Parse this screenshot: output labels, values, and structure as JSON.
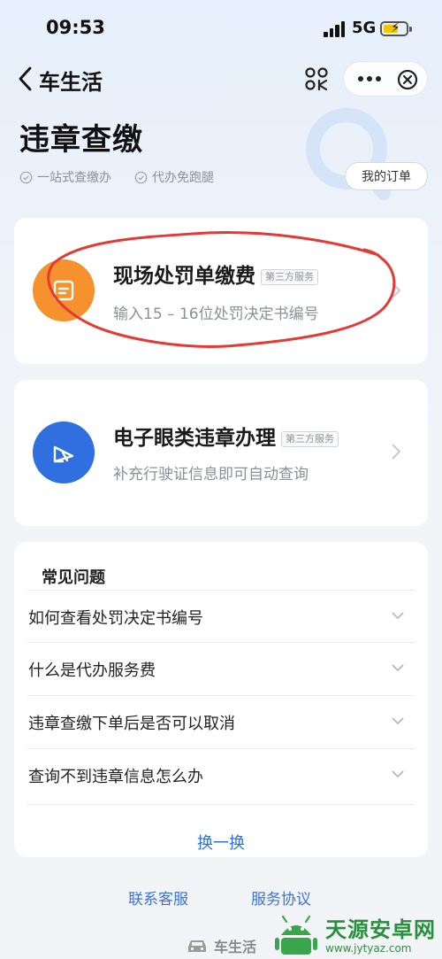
{
  "status_bar": {
    "time": "09:53",
    "network": "5G"
  },
  "nav": {
    "title": "车生活",
    "icons": [
      "back-chevron-icon",
      "scan-icon",
      "more-icon",
      "close-icon"
    ]
  },
  "header": {
    "title": "违章查缴",
    "features": [
      "一站式查缴办",
      "代办免跑腿"
    ],
    "orders_button": "我的订单"
  },
  "services": [
    {
      "title": "现场处罚单缴费",
      "badge": "第三方服务",
      "subtitle": "输入15 – 16位处罚决定书编号",
      "icon": "document-icon",
      "color": "#f6922e"
    },
    {
      "title": "电子眼类违章办理",
      "badge": "第三方服务",
      "subtitle": "补充行驶证信息即可自动查询",
      "icon": "camera-icon",
      "color": "#2f6fe0"
    }
  ],
  "faq": {
    "title": "常见问题",
    "items": [
      "如何查看处罚决定书编号",
      "什么是代办服务费",
      "违章查缴下单后是否可以取消",
      "查询不到违章信息怎么办"
    ],
    "refresh": "换一换"
  },
  "footer": {
    "links": [
      "联系客服",
      "服务协议"
    ],
    "brand": "车生活"
  },
  "watermark": {
    "name": "天源安卓网",
    "url": "www.jytyaz.com"
  },
  "colors": {
    "accent": "#2f6fe0",
    "orange": "#f6922e",
    "annotation": "#e53935"
  }
}
